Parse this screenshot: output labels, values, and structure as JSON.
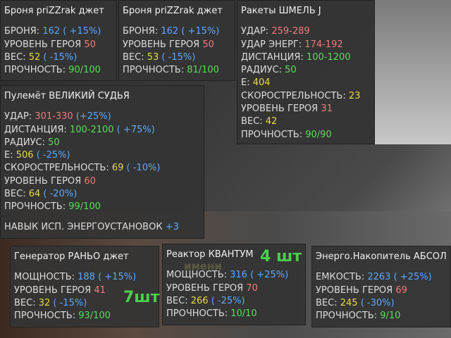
{
  "panels": {
    "armor1": {
      "title": "Броня priZZrak джет",
      "rows": [
        {
          "label": "БРОНЯ: ",
          "value": "162",
          "bonus": " ( +15%)"
        },
        {
          "label": "УРОВЕНЬ ГЕРОЯ ",
          "value": "50"
        },
        {
          "label": "ВЕС: ",
          "value": "52",
          "bonus": " ( -15%)"
        },
        {
          "label": "ПРОЧНОСТЬ: ",
          "value": "90/100"
        }
      ]
    },
    "armor2": {
      "title": "Броня priZZrak джет",
      "rows": [
        {
          "label": "БРОНЯ: ",
          "value": "162",
          "bonus": " ( +15%)"
        },
        {
          "label": "УРОВЕНЬ ГЕРОЯ ",
          "value": "50"
        },
        {
          "label": "ВЕС: ",
          "value": "53",
          "bonus": " ( -15%)"
        },
        {
          "label": "ПРОЧНОСТЬ: ",
          "value": "81/100"
        }
      ]
    },
    "rockets": {
      "title": "Ракеты ШМЕЛЬ J",
      "rows": [
        {
          "label": "УДАР: ",
          "value": "259-289"
        },
        {
          "label": "УДАР ЭНЕРГ: ",
          "value": "174-192"
        },
        {
          "label": "ДИСТАНЦИЯ: ",
          "value": "100-1200"
        },
        {
          "label": "РАДИУС: ",
          "value": "50"
        },
        {
          "label": "Е: ",
          "value": "404"
        },
        {
          "label": "СКОРОСТРЕЛЬНОСТЬ: ",
          "value": "23"
        },
        {
          "label": "УРОВЕНЬ ГЕРОЯ ",
          "value": "31"
        },
        {
          "label": "ВЕС: ",
          "value": "42"
        },
        {
          "label": "ПРОЧНОСТЬ: ",
          "value": "90/90"
        }
      ]
    },
    "machinegun": {
      "title": "Пулемёт ВЕЛИКИЙ СУДЬЯ",
      "rows": [
        {
          "label": "УДАР: ",
          "value": "301-330",
          "bonus": " (+25%)"
        },
        {
          "label": "ДИСТАНЦИЯ: ",
          "value": "100-2100",
          "bonus": " ( +75%)"
        },
        {
          "label": "РАДИУС: ",
          "value": "50"
        },
        {
          "label": "Е: ",
          "value": "506",
          "bonus": " ( -25%)"
        },
        {
          "label": "СКОРОСТРЕЛЬНОСТЬ: ",
          "value": "69",
          "bonus": " ( -10%)"
        },
        {
          "label": "УРОВЕНЬ ГЕРОЯ ",
          "value": "60"
        },
        {
          "label": "ВЕС: ",
          "value": "64",
          "bonus": " ( -20%)"
        },
        {
          "label": "ПРОЧНОСТЬ: ",
          "value": "99/100"
        }
      ],
      "skill_label": "НАВЫК ИСП. ЭНЕРГОУСТАНОВОК ",
      "skill_value": "+3"
    },
    "generator": {
      "title": "Генератор РАНЬО джет",
      "rows": [
        {
          "label": "МОЩНОСТЬ: ",
          "value": "188",
          "bonus": " ( +15%)"
        },
        {
          "label": "УРОВЕНЬ ГЕРОЯ ",
          "value": "41"
        },
        {
          "label": "ВЕС: ",
          "value": "32",
          "bonus": " ( -15%)"
        },
        {
          "label": "ПРОЧНОСТЬ: ",
          "value": "93/100"
        }
      ],
      "count_overlay": "7шт"
    },
    "reactor": {
      "title": "Реактор КВАНТУМ",
      "rows": [
        {
          "label": "МОЩНОСТЬ: ",
          "value": "316",
          "bonus": " ( +25%)"
        },
        {
          "label": "УРОВЕНЬ ГЕРОЯ ",
          "value": "70"
        },
        {
          "label": "ВЕС: ",
          "value": "266",
          "bonus": " ( -25%)"
        },
        {
          "label": "ПРОЧНОСТЬ: ",
          "value": "10/10"
        }
      ],
      "count_overlay": "4 шт",
      "ghost_text": "имени"
    },
    "accumulator": {
      "title": "Энерго.Накопитель АБСОЛ",
      "rows": [
        {
          "label": "ЕМКОСТЬ: ",
          "value": "2263",
          "bonus": " ( +25%)"
        },
        {
          "label": "УРОВЕНЬ ГЕРОЯ ",
          "value": "69"
        },
        {
          "label": "ВЕС: ",
          "value": "245",
          "bonus": " ( -30%)"
        },
        {
          "label": "ПРОЧНОСТЬ: ",
          "value": "9/10"
        }
      ]
    }
  }
}
